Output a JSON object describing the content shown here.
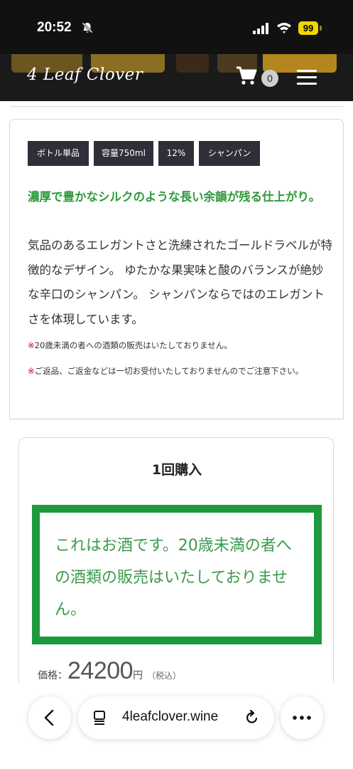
{
  "status_bar": {
    "time": "20:52",
    "battery": "99",
    "icons": [
      "bell-off-icon",
      "signal-icon",
      "wifi-icon",
      "battery-icon"
    ]
  },
  "header": {
    "logo": "4 Leaf Clover",
    "cart_count": "0",
    "icons": [
      "cart-icon",
      "menu-icon"
    ]
  },
  "product": {
    "tags": [
      "ボトル単品",
      "容量750ml",
      "12%",
      "シャンパン"
    ],
    "highlight": "濃厚で豊かなシルクのような長い余韻が残る仕上がり。",
    "description": "気品のあるエレガントさと洗練されたゴールドラベルが特徴的なデザイン。 ゆたかな果実味と酸のバランスが絶妙な辛口のシャンパン。 シャンパンならではのエレガントさを体現しています。",
    "note_mark": "※",
    "notes": [
      "20歳未満の者への酒類の販売はいたしておりません。",
      "ご返品、ご返金などは一切お受付いたしておりませんのでご注意下さい。"
    ]
  },
  "purchase": {
    "title": "1回購入",
    "warning": "これはお酒です。20歳未満の者への酒類の販売はいたしておりません。",
    "price_label": "価格：",
    "price_value": "24200",
    "price_unit": "円",
    "price_tax": "（税込）"
  },
  "browser": {
    "url": "4leafclover.wine",
    "icons": [
      "back-icon",
      "page-icon",
      "reload-icon",
      "more-icon"
    ]
  },
  "colors": {
    "accent_green": "#1d9a3e",
    "text_green": "#2e9a3a",
    "tag_bg": "#2f2f3a",
    "header_bg": "#1a1a1a",
    "note_red": "#d0021b",
    "battery_yellow": "#f2d600"
  }
}
